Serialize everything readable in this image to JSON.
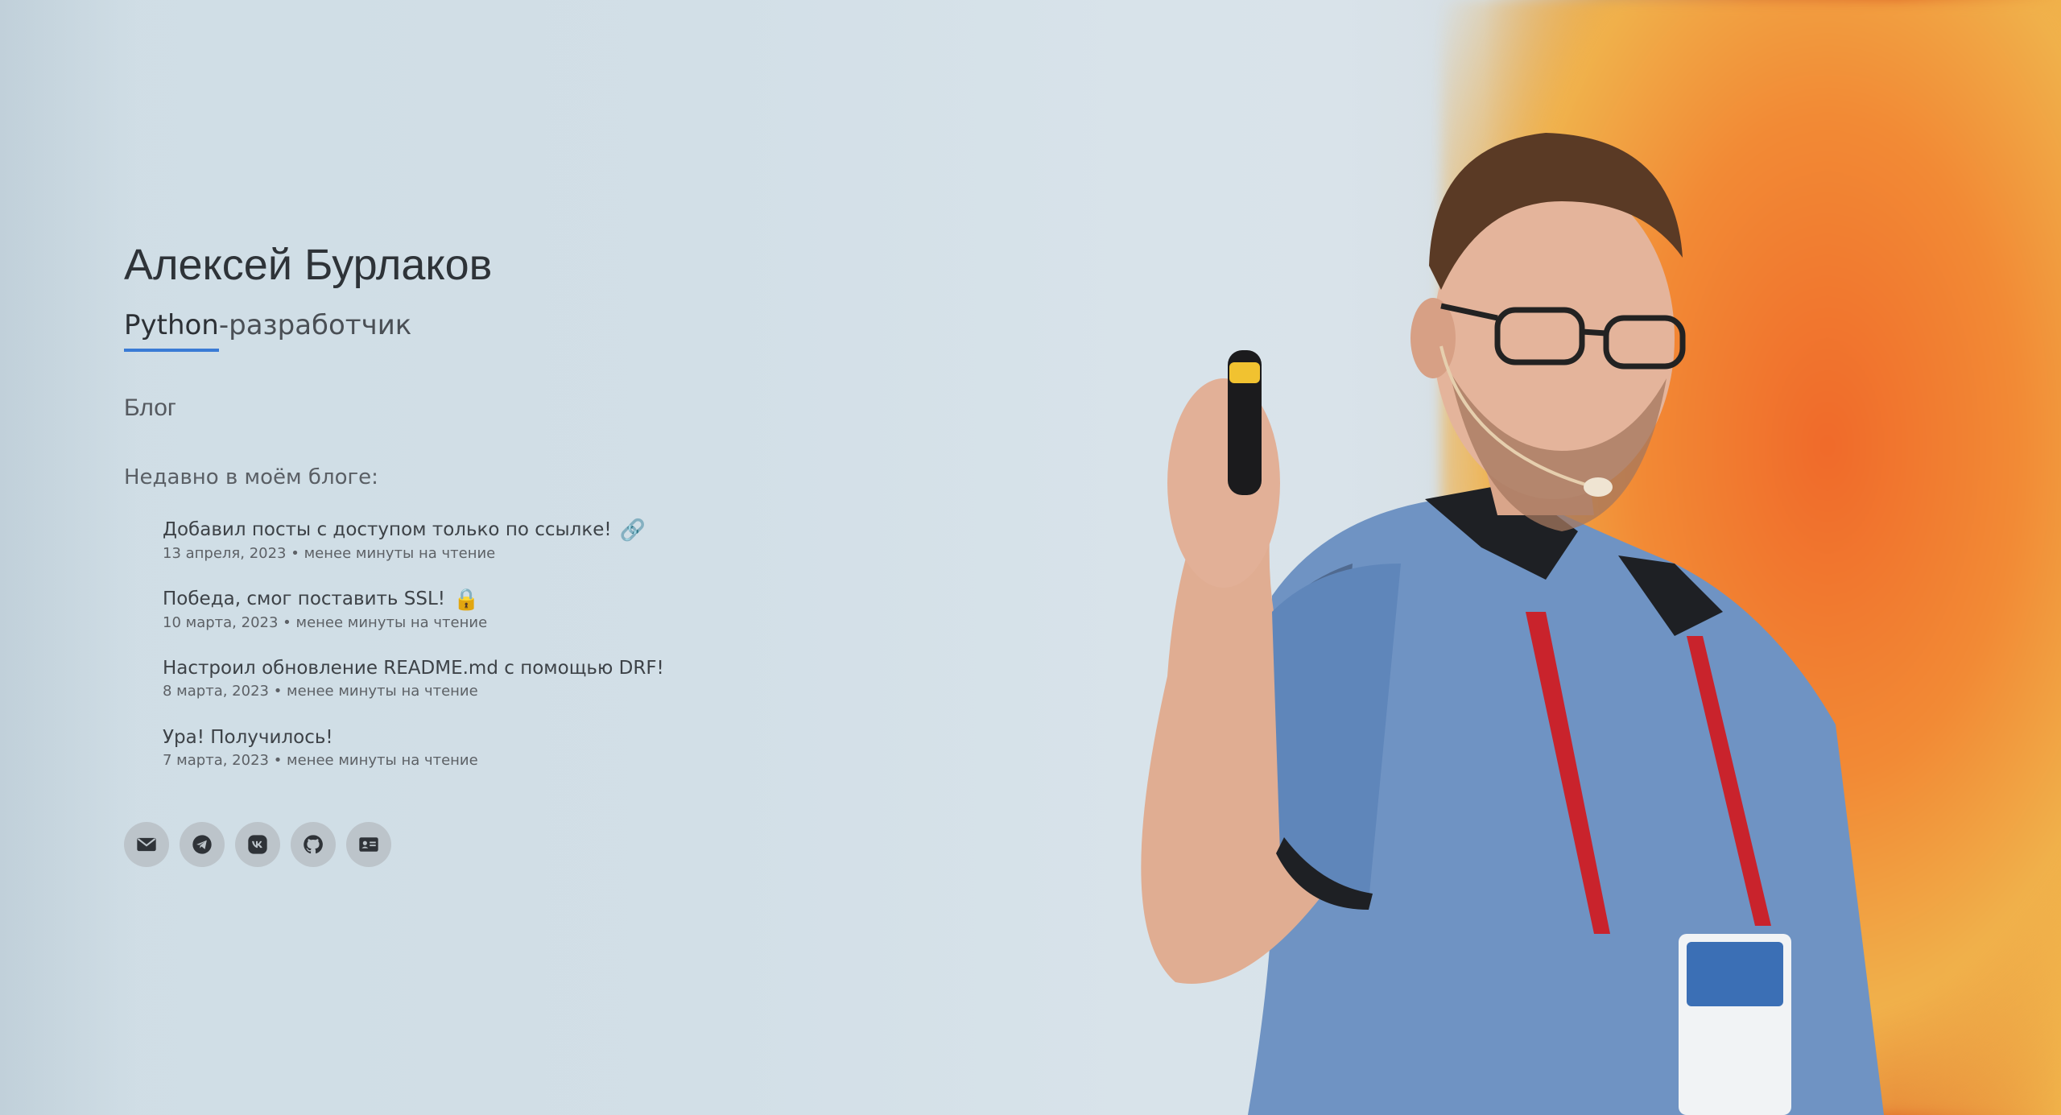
{
  "profile": {
    "name": "Алексей Бурлаков",
    "subtitle_highlight": "Python",
    "subtitle_rest": "-разработчик"
  },
  "nav": {
    "blog_label": "Блог"
  },
  "recent": {
    "heading": "Недавно в моём блоге:",
    "posts": [
      {
        "title": "Добавил посты с доступом только по ссылке!",
        "emoji": "🔗",
        "meta": "13 апреля, 2023 • менее минуты на чтение"
      },
      {
        "title": "Победа, смог поставить SSL!",
        "emoji": "🔒",
        "meta": "10 марта, 2023 • менее минуты на чтение"
      },
      {
        "title": "Настроил обновление README.md с помощью DRF!",
        "emoji": "",
        "meta": "8 марта, 2023 • менее минуты на чтение"
      },
      {
        "title": "Ура! Получилось!",
        "emoji": "",
        "meta": "7 марта, 2023 • менее минуты на чтение"
      }
    ]
  },
  "socials": [
    {
      "icon": "envelope-icon"
    },
    {
      "icon": "telegram-icon"
    },
    {
      "icon": "vk-icon"
    },
    {
      "icon": "github-icon"
    },
    {
      "icon": "id-card-icon"
    }
  ],
  "colors": {
    "accent": "#3a7bd5",
    "social_bg": "#bcc4ca",
    "text_dark": "#2e3338"
  }
}
